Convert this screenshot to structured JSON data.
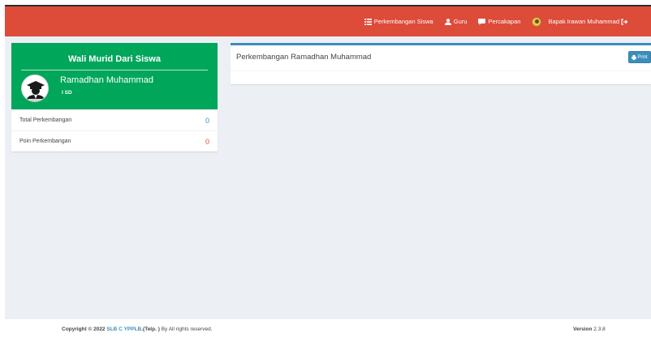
{
  "navbar": {
    "items": [
      {
        "label": "Perkembangan Siswa",
        "icon": "list-icon"
      },
      {
        "label": "Guru",
        "icon": "user-icon"
      },
      {
        "label": "Percakapan",
        "icon": "comment-icon"
      }
    ],
    "user": {
      "label": "Bapak Irawan Muhammad",
      "icon": "sign-out-icon"
    },
    "color": "#dd4b39"
  },
  "widget": {
    "title": "Wali Murid Dari Siswa",
    "name": "Ramadhan Muhammad",
    "class_label": "I SD",
    "color": "#00a65a",
    "stats": [
      {
        "label": "Total Perkembangan",
        "value": "0"
      },
      {
        "label": "Poin Perkembangan",
        "value": "0"
      }
    ]
  },
  "content": {
    "title": "Perkembangan Ramadhan Muhammad",
    "print_label": "Print",
    "accent": "#3c8dbc"
  },
  "footer": {
    "copyright_prefix": "Copyright © 2022",
    "org_link": "SLB C YPPLB",
    "telp": ".(Telp. )",
    "rights": "By All rights reserved.",
    "version_label": "Version",
    "version_value": "2.3.8"
  }
}
